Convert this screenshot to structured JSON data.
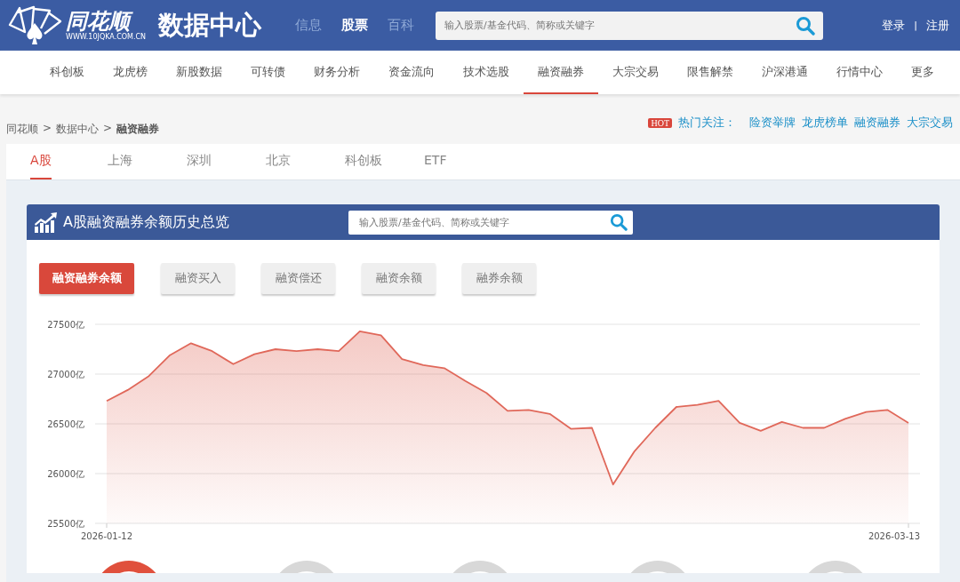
{
  "header": {
    "logo_text": "同花顺",
    "logo_url": "WWW.10JQKA.COM.CN",
    "title": "数据中心",
    "channels": [
      {
        "label": "信息",
        "selected": false
      },
      {
        "label": "股票",
        "selected": true
      },
      {
        "label": "百科",
        "selected": false
      }
    ],
    "search": {
      "placeholder": "输入股票/基金代码、简称或关键字"
    },
    "account": [
      {
        "kind": "link",
        "text": "登录"
      },
      {
        "kind": "sep",
        "text": "|"
      },
      {
        "kind": "link",
        "text": "注册"
      }
    ]
  },
  "nav": [
    {
      "label": "科创板",
      "selected": false
    },
    {
      "label": "龙虎榜",
      "selected": false
    },
    {
      "label": "新股数据",
      "selected": false
    },
    {
      "label": "可转债",
      "selected": false
    },
    {
      "label": "财务分析",
      "selected": false
    },
    {
      "label": "资金流向",
      "selected": false
    },
    {
      "label": "技术选股",
      "selected": false
    },
    {
      "label": "融资融券",
      "selected": true
    },
    {
      "label": "大宗交易",
      "selected": false
    },
    {
      "label": "限售解禁",
      "selected": false
    },
    {
      "label": "沪深港通",
      "selected": false
    },
    {
      "label": "行情中心",
      "selected": false
    },
    {
      "label": "更多",
      "selected": false
    }
  ],
  "breadcrumb": [
    {
      "kind": "link",
      "text": "同花顺"
    },
    {
      "kind": "sep",
      "text": ">"
    },
    {
      "kind": "link",
      "text": "数据中心"
    },
    {
      "kind": "sep",
      "text": ">"
    },
    {
      "kind": "current",
      "text": "融资融券"
    }
  ],
  "hot": {
    "badge": "HOT",
    "label": "热门关注：",
    "links": [
      "险资举牌",
      "龙虎榜单",
      "融资融券",
      "大宗交易"
    ]
  },
  "market_tabs": [
    {
      "label": "A股",
      "selected": true
    },
    {
      "label": "上海",
      "selected": false
    },
    {
      "label": "深圳",
      "selected": false
    },
    {
      "label": "北京",
      "selected": false
    },
    {
      "label": "科创板",
      "selected": false
    },
    {
      "label": "ETF",
      "selected": false
    }
  ],
  "panel": {
    "title": "A股融资融券余额历史总览",
    "search": {
      "placeholder": "输入股票/基金代码、简称或关键字"
    },
    "metric_buttons": [
      {
        "label": "融资融券余额",
        "selected": true
      },
      {
        "label": "融资买入",
        "selected": false
      },
      {
        "label": "融资偿还",
        "selected": false
      },
      {
        "label": "融资余额",
        "selected": false
      },
      {
        "label": "融券余额",
        "selected": false
      }
    ],
    "chart_data": {
      "type": "area",
      "ylim": [
        25500,
        27500
      ],
      "yticks": [
        {
          "value": 25500,
          "label": "25500亿"
        },
        {
          "value": 26000,
          "label": "26000亿"
        },
        {
          "value": 26500,
          "label": "26500亿"
        },
        {
          "value": 27000,
          "label": "27000亿"
        },
        {
          "value": 27500,
          "label": "27500亿"
        }
      ],
      "grid": true,
      "series": [
        {
          "color": "#e0685a",
          "values": [
            26730,
            26840,
            26980,
            27190,
            27310,
            27230,
            27100,
            27200,
            27250,
            27230,
            27250,
            27230,
            27430,
            27390,
            27150,
            27090,
            27060,
            26930,
            26810,
            26630,
            26640,
            26600,
            26450,
            26460,
            25890,
            26220,
            26460,
            26670,
            26690,
            26730,
            26510,
            26430,
            26520,
            26460,
            26460,
            26550,
            26620,
            26640,
            26510
          ]
        }
      ]
    },
    "axis_dates": [
      "2026-01-12",
      "2026-03-13"
    ]
  }
}
